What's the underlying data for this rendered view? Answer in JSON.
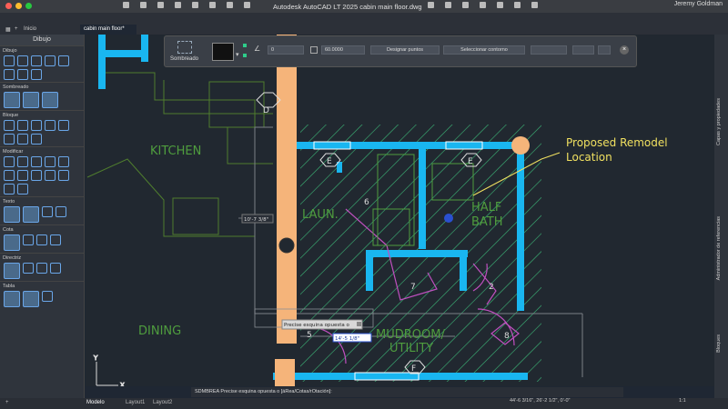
{
  "app": {
    "window_title": "Autodesk AutoCAD LT 2025   cabin main floor.dwg",
    "user": "Jeremy Goldman",
    "home_tab": "Inicio",
    "doc_tab": "cabin main floor*",
    "accent": "#5aaaf0"
  },
  "palette": {
    "title": "Dibujo",
    "sections": [
      "Dibujo",
      "Sombreado",
      "Bloque",
      "Modificar",
      "Texto",
      "Cota",
      "Directriz",
      "Tabla"
    ]
  },
  "ctx_panel": {
    "hatch_label": "Sombreado",
    "angle_value": "0",
    "scale_value": "60.0000",
    "pick_points": "Designar puntos",
    "select_boundary": "Seleccionar contorno"
  },
  "drawing": {
    "rooms": [
      "KITCHEN",
      "LAUN.",
      "HALF\nBATH",
      "DINING",
      "MUDROOM/\nUTILITY"
    ],
    "room_kitchen": "KITCHEN",
    "room_laun": "LAUN.",
    "room_half": "HALF",
    "room_bath": "BATH",
    "room_dining": "DINING",
    "room_mudroom": "MUDROOM/",
    "room_utility": "UTILITY",
    "annotation_line1": "Proposed Remodel",
    "annotation_line2": "Location",
    "tags": [
      "D",
      "E",
      "E",
      "6",
      "7",
      "2",
      "5",
      "8",
      "F"
    ],
    "dim_readout": "10'-7 3/8\"",
    "dyn_prompt": "Precise esquina opuesta o",
    "dyn_input": "14'-5 1/8\""
  },
  "command_line": "SDMBREA Precise esquina opuesta o [áRea/Cotas/rOtación]:",
  "layout_tabs": [
    "Modelo",
    "Layout1",
    "Layout2"
  ],
  "status": {
    "coords": "44'-6 3/16\",  26'-2 1/2\", 0'-0\"",
    "scale": "1:1"
  },
  "right_panels": [
    "Capas y propiedades",
    "Administrador de referencias",
    "Bloques"
  ]
}
